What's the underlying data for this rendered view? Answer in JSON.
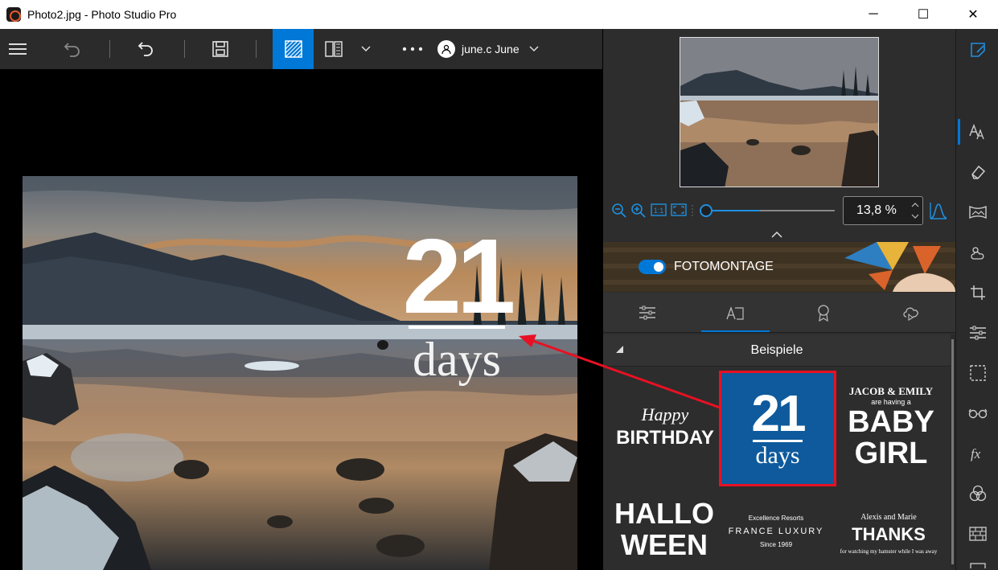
{
  "window": {
    "title": "Photo2.jpg - Photo Studio Pro",
    "minimize": "─",
    "maximize": "☐",
    "close": "✕"
  },
  "toolbar": {
    "user_name": "june.c June"
  },
  "overlay": {
    "number": "21",
    "word": "days"
  },
  "zoom": {
    "value": "13,8 %",
    "slider_fraction": 0.42
  },
  "banner": {
    "label": "FOTOMONTAGE",
    "toggle_on": true
  },
  "section": {
    "title": "Beispiele"
  },
  "templates": {
    "birthday": {
      "line1": "Happy",
      "line2": "BIRTHDAY"
    },
    "days": {
      "number": "21",
      "word": "days"
    },
    "baby": {
      "line1": "JACOB & EMILY",
      "line2": "are having a",
      "line3": "BABY",
      "line4": "GIRL"
    },
    "halloween": {
      "line1": "HALLO",
      "line2": "WEEN"
    },
    "resort": {
      "line1": "Excellence Resorts",
      "line2": "FRANCE LUXURY",
      "line3": "Since 1969"
    },
    "thanks": {
      "line1": "Alexis and Marie",
      "line2": "THANKS",
      "line3": "for watching my hamster while I was away"
    }
  },
  "colors": {
    "accent": "#0078d7",
    "highlight": "#e81123",
    "template_blue": "#0e5a9c"
  }
}
